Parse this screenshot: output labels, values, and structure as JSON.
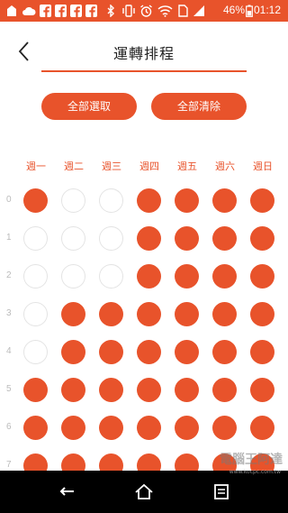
{
  "status_bar": {
    "battery_percent": "46%",
    "time": "01:12",
    "background": "#e8532b"
  },
  "header": {
    "title": "運轉排程",
    "back_icon": "chevron-left-icon"
  },
  "actions": {
    "select_all": "全部選取",
    "clear_all": "全部清除"
  },
  "days": [
    "週一",
    "週二",
    "週三",
    "週四",
    "週五",
    "週六",
    "週日"
  ],
  "hours": [
    "0",
    "1",
    "2",
    "3",
    "4",
    "5",
    "6",
    "7"
  ],
  "schedule": [
    [
      1,
      0,
      0,
      1,
      1,
      1,
      1
    ],
    [
      0,
      0,
      0,
      1,
      1,
      1,
      1
    ],
    [
      0,
      0,
      0,
      1,
      1,
      1,
      1
    ],
    [
      0,
      1,
      1,
      1,
      1,
      1,
      1
    ],
    [
      0,
      1,
      1,
      1,
      1,
      1,
      1
    ],
    [
      1,
      1,
      1,
      1,
      1,
      1,
      1
    ],
    [
      1,
      1,
      1,
      1,
      1,
      1,
      1
    ],
    [
      1,
      1,
      1,
      1,
      1,
      1,
      1
    ]
  ],
  "colors": {
    "accent": "#e8532b",
    "inactive_border": "#e4e4e4",
    "hour_label": "#bbbbbb"
  },
  "nav_bar": {
    "back_icon": "back-arrow-icon",
    "home_icon": "home-icon",
    "recents_icon": "recents-icon"
  },
  "watermark": {
    "text": "電腦王阿達",
    "sub": "www.kocpc.com.tw"
  }
}
